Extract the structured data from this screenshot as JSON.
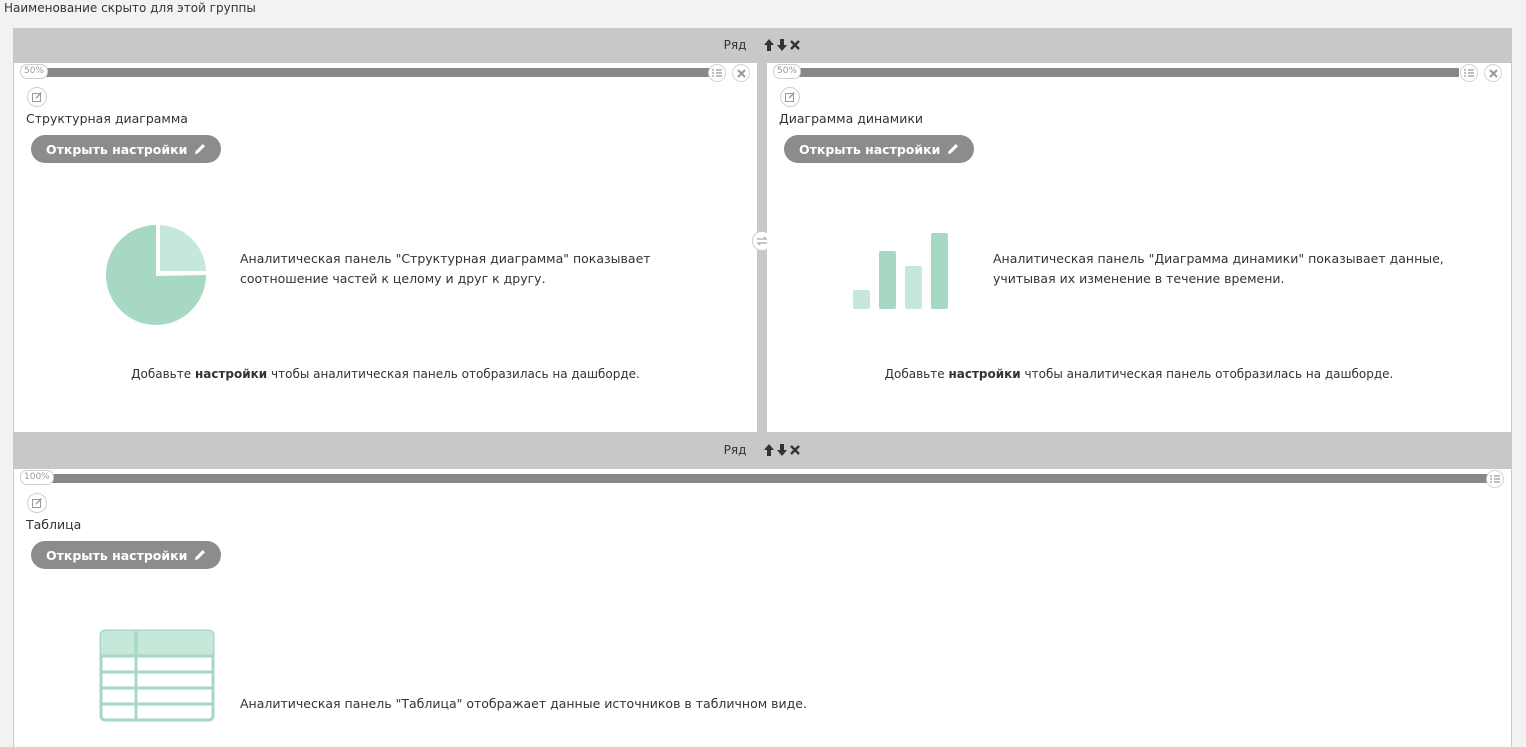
{
  "group": {
    "name": "Наименование скрыто для этой группы"
  },
  "rows": [
    {
      "label": "Ряд"
    },
    {
      "label": "Ряд"
    }
  ],
  "panels": [
    {
      "width_label": "50%",
      "title": "Структурная диаграмма",
      "open_settings": "Открыть настройки",
      "description_line1": "Аналитическая панель \"Структурная диаграмма\" показывает",
      "description_line2": "соотношение частей к целому и друг к другу.",
      "hint_pre": "Добавьте ",
      "hint_bold": "настройки",
      "hint_post": " чтобы аналитическая панель отобразилась на дашборде.",
      "icon": "pie-chart-icon"
    },
    {
      "width_label": "50%",
      "title": "Диаграмма динамики",
      "open_settings": "Открыть настройки",
      "description_line1": "Аналитическая панель \"Диаграмма динамики\" показывает данные,",
      "description_line2": "учитывая их изменение в течение времени.",
      "hint_pre": "Добавьте ",
      "hint_bold": "настройки",
      "hint_post": " чтобы аналитическая панель отобразилась на дашборде.",
      "icon": "bar-chart-icon"
    },
    {
      "width_label": "100%",
      "title": "Таблица",
      "open_settings": "Открыть настройки",
      "description_line1": "Аналитическая панель \"Таблица\" отображает данные источников в табличном виде.",
      "icon": "table-icon"
    }
  ],
  "colors": {
    "accent_green": "#a6d8c3",
    "accent_green_light": "#c5e8da",
    "slider": "#888888",
    "button": "#8c8c8c",
    "frame": "#c8c8c8"
  }
}
